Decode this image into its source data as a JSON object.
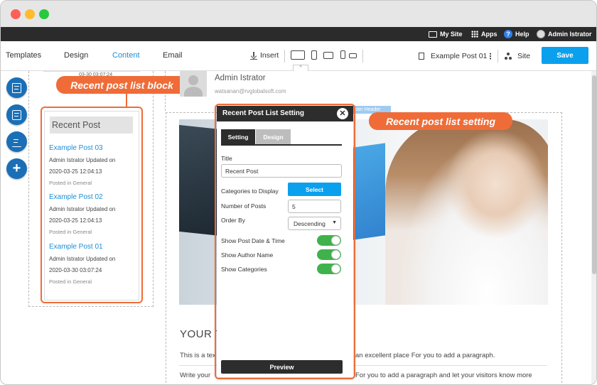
{
  "topbar": {
    "my_site": "My Site",
    "apps": "Apps",
    "help_glyph": "?",
    "help": "Help",
    "user": "Admin Istrator"
  },
  "toolbar": {
    "tabs": [
      "Templates",
      "Design",
      "Content",
      "Email"
    ],
    "active_tab": "Content",
    "insert": "Insert",
    "page_name": "Example Post 01",
    "site": "Site",
    "save": "Save"
  },
  "sidebar_buttons": [
    "page-settings-icon",
    "save-layout-icon",
    "edit-content-icon",
    "add-icon"
  ],
  "add_glyph": "+",
  "recent_post_block": {
    "title": "Recent Post",
    "top_timestamp": "03-30 03:07:24",
    "posts": [
      {
        "title": "Example Post 03",
        "meta": "Admin Istrator Updated on",
        "date": "2020-03-25 12:04:13",
        "category": "Posted in General"
      },
      {
        "title": "Example Post 02",
        "meta": "Admin Istrator Updated on",
        "date": "2020-03-25 12:04:13",
        "category": "Posted in General"
      },
      {
        "title": "Example Post 01",
        "meta": "Admin Istrator Updated on",
        "date": "2020-03-30 03:07:24",
        "category": "Posted in General"
      }
    ]
  },
  "author": {
    "name": "Admin Istrator",
    "email": "watsanan@rvglobalsoft.com"
  },
  "header_badge": "ster Header",
  "callouts": {
    "block": "Recent post list block",
    "setting": "Recent post list setting"
  },
  "panel": {
    "title": "Recent Post List Setting",
    "close_glyph": "✕",
    "tabs": [
      "Setting",
      "Design"
    ],
    "title_label": "Title",
    "title_value": "Recent Post",
    "categories_label": "Categories to Display",
    "select_button": "Select",
    "num_posts_label": "Number of Posts",
    "num_posts_value": "5",
    "order_label": "Order By",
    "order_value": "Descending",
    "caret_glyph": "▼",
    "toggles": [
      {
        "label": "Show Post Date & Time",
        "on": true
      },
      {
        "label": "Show Author Name",
        "on": true
      },
      {
        "label": "Show Categories",
        "on": true
      }
    ],
    "preview_button": "Preview"
  },
  "body_text": {
    "heading": "YOUR T",
    "para1_left": "This is a tex",
    "para1_right": "an excellent place For you to add a paragraph.",
    "para2_left": "Write your",
    "para2_right": "For you to add a paragraph and let your visitors know more"
  },
  "colors": {
    "accent": "#0ba0ee",
    "active_tab": "#1a8fd6",
    "callout": "#ef6c38",
    "sidebar_button": "#1a6fb7",
    "toggle_on": "#3fb24b",
    "panel_dark": "#2d2d2d"
  }
}
